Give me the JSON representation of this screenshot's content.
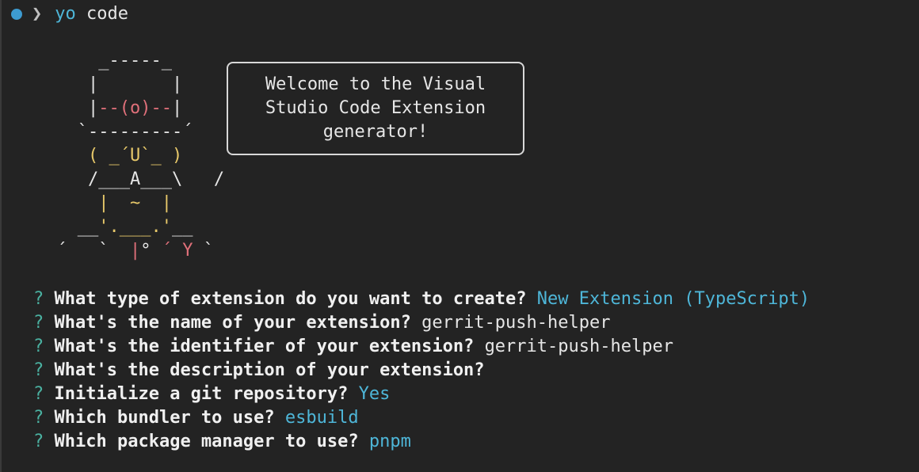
{
  "prompt": {
    "symbol": "❯",
    "command": "yo",
    "argument": "code"
  },
  "ascii_art": {
    "line1": "     _-----_     ",
    "line2": "    |       |    ",
    "line3_pre": "    |",
    "line3_red": "--(o)--",
    "line3_post": "|    ",
    "line4": "   `---------´   ",
    "line5_pre": "    ",
    "line5_yellow": "( _´U`_ )",
    "line6": "    /___A___\\   /",
    "line7_pre": "     ",
    "line7_yellow": "|  ~  |",
    "line8_pre": "   __",
    "line8_yellow": "'.___.'",
    "line8_post": "__   ",
    "line9_pre": " ´   `  ",
    "line9_red1": "|",
    "line9_mid": "° ",
    "line9_red2": "´ Y",
    "line9_post": " ` "
  },
  "welcome": {
    "line1": "Welcome to the Visual",
    "line2": "Studio Code Extension",
    "line3": "generator!"
  },
  "questions": [
    {
      "mark": "?",
      "text": "What type of extension do you want to create?",
      "answer": "New Extension (TypeScript)",
      "answer_style": "cyan"
    },
    {
      "mark": "?",
      "text": "What's the name of your extension?",
      "answer": "gerrit-push-helper",
      "answer_style": "plain"
    },
    {
      "mark": "?",
      "text": "What's the identifier of your extension?",
      "answer": "gerrit-push-helper",
      "answer_style": "plain"
    },
    {
      "mark": "?",
      "text": "What's the description of your extension?",
      "answer": "",
      "answer_style": "plain"
    },
    {
      "mark": "?",
      "text": "Initialize a git repository?",
      "answer": "Yes",
      "answer_style": "cyan"
    },
    {
      "mark": "?",
      "text": "Which bundler to use?",
      "answer": "esbuild",
      "answer_style": "cyan"
    },
    {
      "mark": "?",
      "text": "Which package manager to use?",
      "answer": "pnpm",
      "answer_style": "cyan"
    }
  ],
  "colors": {
    "background": "#232323",
    "prompt_dot": "#3d9bd1",
    "command": "#4eb6d8",
    "question_mark": "#4ab0a0",
    "answer_highlight": "#4eb6d8",
    "ascii_yellow": "#e8c96a",
    "ascii_red": "#e0707a"
  },
  "icons": {
    "prompt_status": "status-dot-icon"
  }
}
